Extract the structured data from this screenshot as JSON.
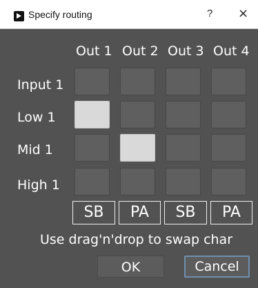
{
  "window": {
    "title": "Specify routing",
    "help": "?",
    "close": "×"
  },
  "columns": [
    "Out 1",
    "Out 2",
    "Out 3",
    "Out 4"
  ],
  "rows": [
    {
      "label": "Input 1",
      "active": [
        false,
        false,
        false,
        false
      ]
    },
    {
      "label": "Low 1",
      "active": [
        true,
        false,
        false,
        false
      ]
    },
    {
      "label": "Mid 1",
      "active": [
        false,
        true,
        false,
        false
      ]
    },
    {
      "label": "High 1",
      "active": [
        false,
        false,
        false,
        false
      ]
    }
  ],
  "output_labels": [
    "SB",
    "PA",
    "SB",
    "PA"
  ],
  "hint": "Use drag'n'drop to swap char",
  "buttons": {
    "ok": "OK",
    "cancel": "Cancel"
  },
  "colors": {
    "background": "#525252",
    "cell_off": "#5f5f5f",
    "cell_on": "#d9d9d9",
    "focus_border": "#6f8fb0"
  }
}
